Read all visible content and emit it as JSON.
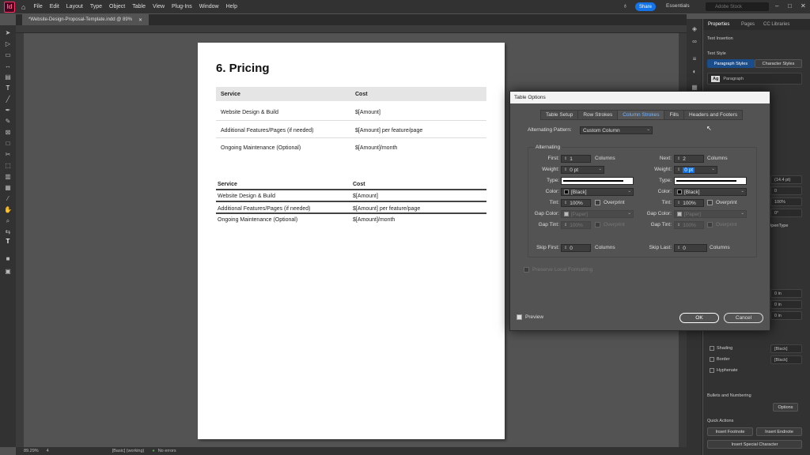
{
  "menubar": {
    "logo": "Id",
    "items": [
      "File",
      "Edit",
      "Layout",
      "Type",
      "Object",
      "Table",
      "View",
      "Plug-Ins",
      "Window",
      "Help"
    ],
    "share": "Share",
    "workspace": "Essentials",
    "search_placeholder": "Adobe Stock"
  },
  "document": {
    "tab": "*Website-Design-Proposal-Template.indd @ 89%"
  },
  "page": {
    "title": "6. Pricing",
    "table1": {
      "headers": [
        "Service",
        "Cost"
      ],
      "rows": [
        [
          "Website Design & Build",
          "$[Amount]"
        ],
        [
          "Additional Features/Pages (if needed)",
          "$[Amount] per feature/page"
        ],
        [
          "Ongoing Maintenance (Optional)",
          "$[Amount]/month"
        ]
      ]
    },
    "table2": {
      "headers": [
        "Service",
        "Cost"
      ],
      "rows": [
        [
          "Website Design & Build",
          "$[Amount]"
        ],
        [
          "Additional Features/Pages (if needed)",
          "$[Amount] per feature/page"
        ],
        [
          "Ongoing Maintenance (Optional)",
          "$[Amount]/month"
        ]
      ]
    }
  },
  "status": {
    "zoom": "89.29%",
    "page": "4",
    "style": "[Basic] (working)",
    "errors": "No errors"
  },
  "properties": {
    "tabs": [
      "Properties",
      "Pages",
      "CC Libraries"
    ],
    "section_text_insertion": "Text Insertion",
    "section_text_style": "Text Style",
    "style_tabs": [
      "Paragraph Styles",
      "Character Styles"
    ],
    "paragraph_style": "Paragraph",
    "leading": "(14.4 pt)",
    "f1": "0",
    "f2": "100%",
    "f3": "0°",
    "opentype": "OpenType",
    "in1": "0 in",
    "in2": "0 in",
    "in3": "0 in",
    "shading": "Shading",
    "border": "Border",
    "hyphenate": "Hyphenate",
    "black1": "[Black]",
    "black2": "[Black]",
    "bullets": "Bullets and Numbering",
    "options": "Options",
    "quick_actions": "Quick Actions",
    "insert_footnote": "Insert Footnote",
    "insert_endnote": "Insert Endnote",
    "insert_special": "Insert Special Character"
  },
  "dialog": {
    "title": "Table Options",
    "tabs": [
      "Table Setup",
      "Row Strokes",
      "Column Strokes",
      "Fills",
      "Headers and Footers"
    ],
    "alternating_pattern_label": "Alternating Pattern:",
    "alternating_pattern_value": "Custom Column",
    "alternating_label": "Alternating",
    "left": {
      "first_label": "First:",
      "first_value": "1",
      "first_unit": "Columns",
      "weight_label": "Weight:",
      "weight_value": "0 pt",
      "type_label": "Type:",
      "color_label": "Color:",
      "color_value": "[Black]",
      "tint_label": "Tint:",
      "tint_value": "100%",
      "overprint": "Overprint",
      "gap_color_label": "Gap Color:",
      "gap_color_value": "[Paper]",
      "gap_tint_label": "Gap Tint:",
      "gap_tint_value": "100%",
      "gap_overprint": "Overprint"
    },
    "right": {
      "next_label": "Next:",
      "next_value": "2",
      "next_unit": "Columns",
      "weight_label": "Weight:",
      "weight_value": "0 pt",
      "type_label": "Type:",
      "color_label": "Color:",
      "color_value": "[Black]",
      "tint_label": "Tint:",
      "tint_value": "100%",
      "overprint": "Overprint",
      "gap_color_label": "Gap Color:",
      "gap_color_value": "[Paper]",
      "gap_tint_label": "Gap Tint:",
      "gap_tint_value": "100%",
      "gap_overprint": "Overprint"
    },
    "skip_first_label": "Skip First:",
    "skip_first_value": "0",
    "skip_first_unit": "Columns",
    "skip_last_label": "Skip Last:",
    "skip_last_value": "0",
    "skip_last_unit": "Columns",
    "preserve_local": "Preserve Local Formatting",
    "preview": "Preview",
    "ok": "OK",
    "cancel": "Cancel"
  }
}
